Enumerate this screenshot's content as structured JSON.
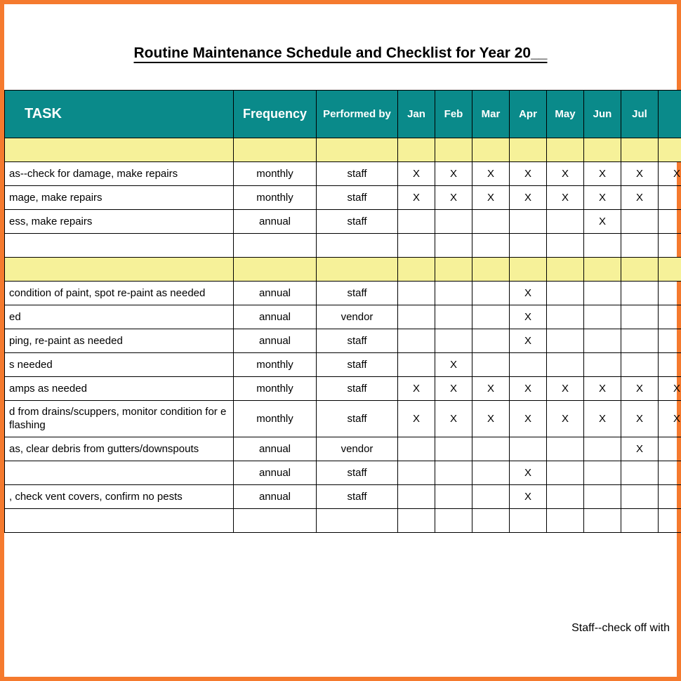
{
  "title": "Routine Maintenance Schedule and Checklist for Year 20__",
  "headers": {
    "task": "TASK",
    "frequency": "Frequency",
    "performed_by": "Performed by"
  },
  "months": [
    "Jan",
    "Feb",
    "Mar",
    "Apr",
    "May",
    "Jun",
    "Jul",
    ""
  ],
  "mark": "X",
  "rows": [
    {
      "type": "section"
    },
    {
      "type": "data",
      "task": "as--check for damage, make repairs",
      "frequency": "monthly",
      "performed_by": "staff",
      "marks": [
        true,
        true,
        true,
        true,
        true,
        true,
        true,
        true
      ]
    },
    {
      "type": "data",
      "task": "mage, make repairs",
      "frequency": "monthly",
      "performed_by": "staff",
      "marks": [
        true,
        true,
        true,
        true,
        true,
        true,
        true,
        false
      ]
    },
    {
      "type": "data",
      "task": "ess, make repairs",
      "frequency": "annual",
      "performed_by": "staff",
      "marks": [
        false,
        false,
        false,
        false,
        false,
        true,
        false,
        false
      ]
    },
    {
      "type": "data",
      "task": "",
      "frequency": "",
      "performed_by": "",
      "marks": [
        false,
        false,
        false,
        false,
        false,
        false,
        false,
        false
      ]
    },
    {
      "type": "section"
    },
    {
      "type": "data",
      "task": "condition of paint, spot re-paint as needed",
      "frequency": "annual",
      "performed_by": "staff",
      "marks": [
        false,
        false,
        false,
        true,
        false,
        false,
        false,
        false
      ]
    },
    {
      "type": "data",
      "task": "ed",
      "frequency": "annual",
      "performed_by": "vendor",
      "marks": [
        false,
        false,
        false,
        true,
        false,
        false,
        false,
        false
      ]
    },
    {
      "type": "data",
      "task": "ping, re-paint as needed",
      "frequency": "annual",
      "performed_by": "staff",
      "marks": [
        false,
        false,
        false,
        true,
        false,
        false,
        false,
        false
      ]
    },
    {
      "type": "data",
      "task": "s needed",
      "frequency": "monthly",
      "performed_by": "staff",
      "marks": [
        false,
        true,
        false,
        false,
        false,
        false,
        false,
        false
      ]
    },
    {
      "type": "data",
      "task": "amps as needed",
      "frequency": "monthly",
      "performed_by": "staff",
      "marks": [
        true,
        true,
        true,
        true,
        true,
        true,
        true,
        true
      ]
    },
    {
      "type": "data",
      "task": "d from drains/scuppers, monitor condition for e flashing",
      "frequency": "monthly",
      "performed_by": "staff",
      "marks": [
        true,
        true,
        true,
        true,
        true,
        true,
        true,
        true
      ],
      "twoLine": true
    },
    {
      "type": "data",
      "task": "as, clear debris from gutters/downspouts",
      "frequency": "annual",
      "performed_by": "vendor",
      "marks": [
        false,
        false,
        false,
        false,
        false,
        false,
        true,
        false
      ]
    },
    {
      "type": "data",
      "task": "",
      "frequency": "annual",
      "performed_by": "staff",
      "marks": [
        false,
        false,
        false,
        true,
        false,
        false,
        false,
        false
      ]
    },
    {
      "type": "data",
      "task": ", check vent covers, confirm no pests",
      "frequency": "annual",
      "performed_by": "staff",
      "marks": [
        false,
        false,
        false,
        true,
        false,
        false,
        false,
        false
      ]
    },
    {
      "type": "data",
      "task": "",
      "frequency": "",
      "performed_by": "",
      "marks": [
        false,
        false,
        false,
        false,
        false,
        false,
        false,
        false
      ]
    }
  ],
  "footer_note": "Staff--check off with"
}
